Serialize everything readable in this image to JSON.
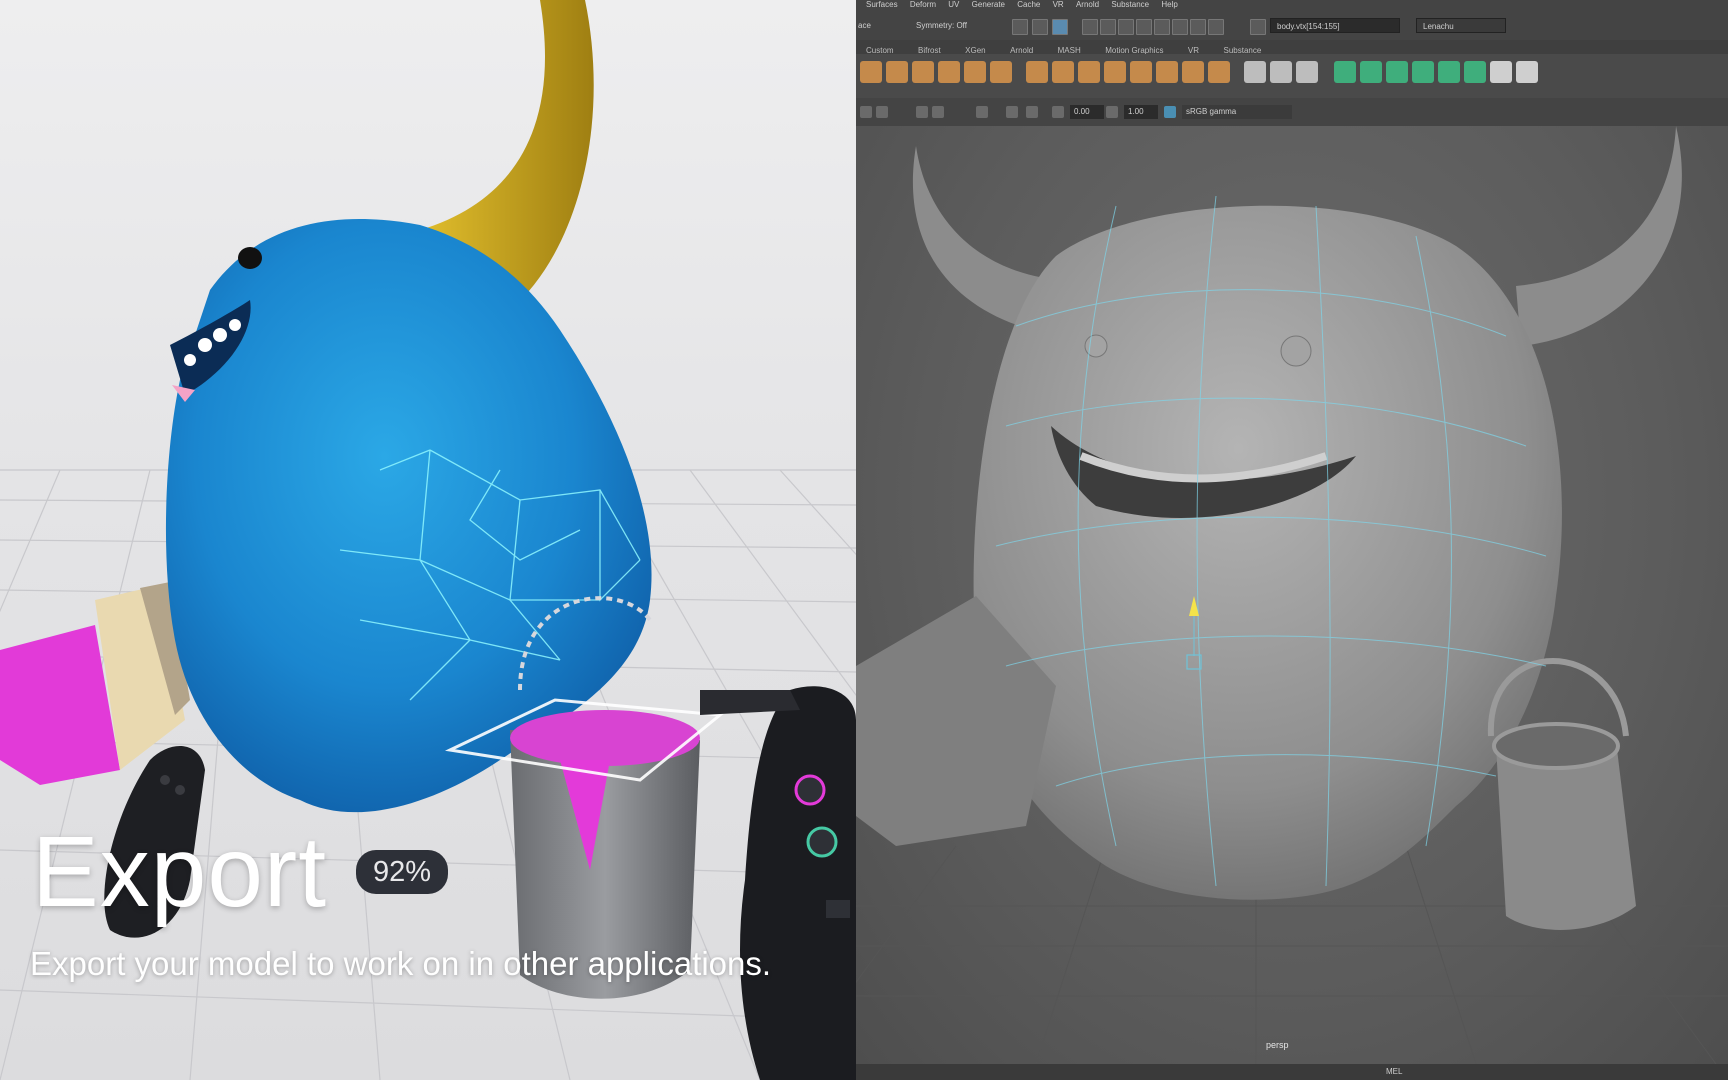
{
  "vr_panel": {
    "title": "Export",
    "progress_label": "92%",
    "progress_percent": 92,
    "description": "Export your model to work on in other applications.",
    "colors": {
      "character": "#1e8fd3",
      "horn": "#c9a526",
      "paint": "#e033d6",
      "wireframe": "#8ff7ff"
    }
  },
  "maya": {
    "menus": [
      "Surfaces",
      "Deform",
      "UV",
      "Generate",
      "Cache",
      "VR",
      "Arnold",
      "Substance",
      "Help"
    ],
    "status": {
      "workspace_partial": "ace",
      "symmetry": "Symmetry: Off",
      "selection_field": "body.vtx[154:155]",
      "user": "Lenachu"
    },
    "shelf_tabs": [
      "Custom",
      "Bifrost",
      "XGen",
      "Arnold",
      "MASH",
      "Motion Graphics",
      "VR",
      "Substance"
    ],
    "viewport_toolbar": {
      "value_1": "0.00",
      "value_2": "1.00",
      "color_space": "sRGB gamma"
    },
    "camera_label": "persp",
    "command_line_label": "MEL"
  }
}
